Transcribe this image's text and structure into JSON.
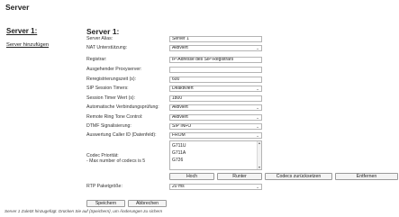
{
  "page_title": "Server",
  "sidebar": {
    "title": "Server 1:",
    "add_link": "Server hinzufügen"
  },
  "form": {
    "title": "Server 1:",
    "rows": [
      {
        "label": "Server Alias:",
        "value": "Server 1",
        "type": "text"
      },
      {
        "label": "NAT Unterstützung:",
        "value": "Aktiviert",
        "type": "select"
      },
      {
        "label": "Registrar:",
        "value": "IP-Adresse des SIP-Registrars",
        "type": "text"
      },
      {
        "label": "Ausgehender Proxyserver:",
        "value": "",
        "type": "text"
      },
      {
        "label": "Reregistrierungszeit (s):",
        "value": "600",
        "type": "text"
      },
      {
        "label": "SIP Session Timers:",
        "value": "Deaktiviert",
        "type": "select"
      },
      {
        "label": "Session Timer Wert (s):",
        "value": "1800",
        "type": "text"
      },
      {
        "label": "Automatische Verbindungsprüfung:",
        "value": "Aktiviert",
        "type": "select"
      },
      {
        "label": "Remote Ring Tone Control:",
        "value": "Aktiviert",
        "type": "select"
      },
      {
        "label": "DTMF Signalisierung:",
        "value": "SIP INFO",
        "type": "select"
      },
      {
        "label": "Auswertung Caller ID (Datenfeld):",
        "value": "FROM",
        "type": "select"
      }
    ],
    "codec": {
      "label": "Codec Priorität:",
      "note": "- Max number of codecs is 5",
      "items": [
        "G711U",
        "G711A",
        "G726"
      ],
      "buttons": {
        "up": "Hoch",
        "down": "Runter",
        "reset": "Codecs zurücksetzen",
        "remove": "Entfernen"
      }
    },
    "rtp": {
      "label": "RTP Paketgröße:",
      "value": "20 ms"
    },
    "actions": {
      "save": "Speichern",
      "cancel": "Abbrechen"
    }
  },
  "footer": "Server 1 Zuletzt hinzugefügt. Drücken Sie auf {Speichern}, um Änderungen zu sichern",
  "icons": {
    "dropdown": "chevron-down-icon",
    "scroll_up": "scroll-up-icon",
    "scroll_down": "scroll-down-icon"
  }
}
